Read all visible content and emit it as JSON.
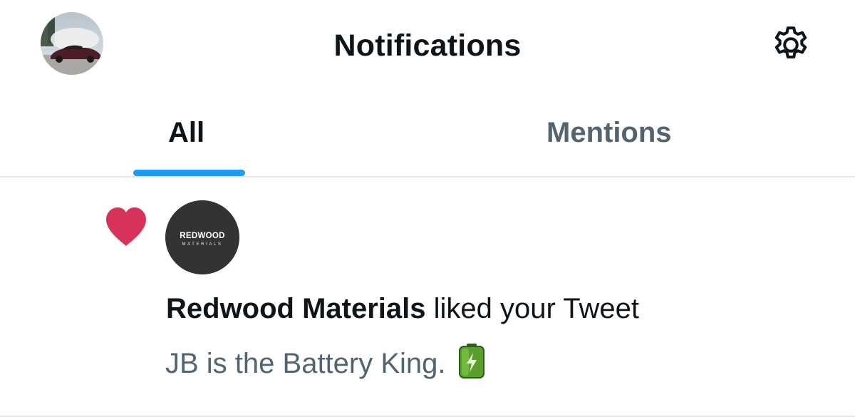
{
  "header": {
    "title": "Notifications",
    "settings_icon": "gear-icon",
    "profile_avatar": "user-avatar"
  },
  "tabs": [
    {
      "label": "All",
      "active": true
    },
    {
      "label": "Mentions",
      "active": false
    }
  ],
  "colors": {
    "accent": "#1d9bf0",
    "like": "#d7335a",
    "secondary_text": "#536471",
    "primary_text": "#0f1419",
    "divider": "#e6e6e6"
  },
  "notification": {
    "type_icon": "heart-icon",
    "actor_name": "Redwood Materials",
    "action": " liked your Tweet",
    "tweet_text": "JB is the Battery King.",
    "emoji_icon": "battery-icon",
    "actor_logo": {
      "brand": "REDWOOD",
      "sub": "MATERIALS"
    }
  }
}
